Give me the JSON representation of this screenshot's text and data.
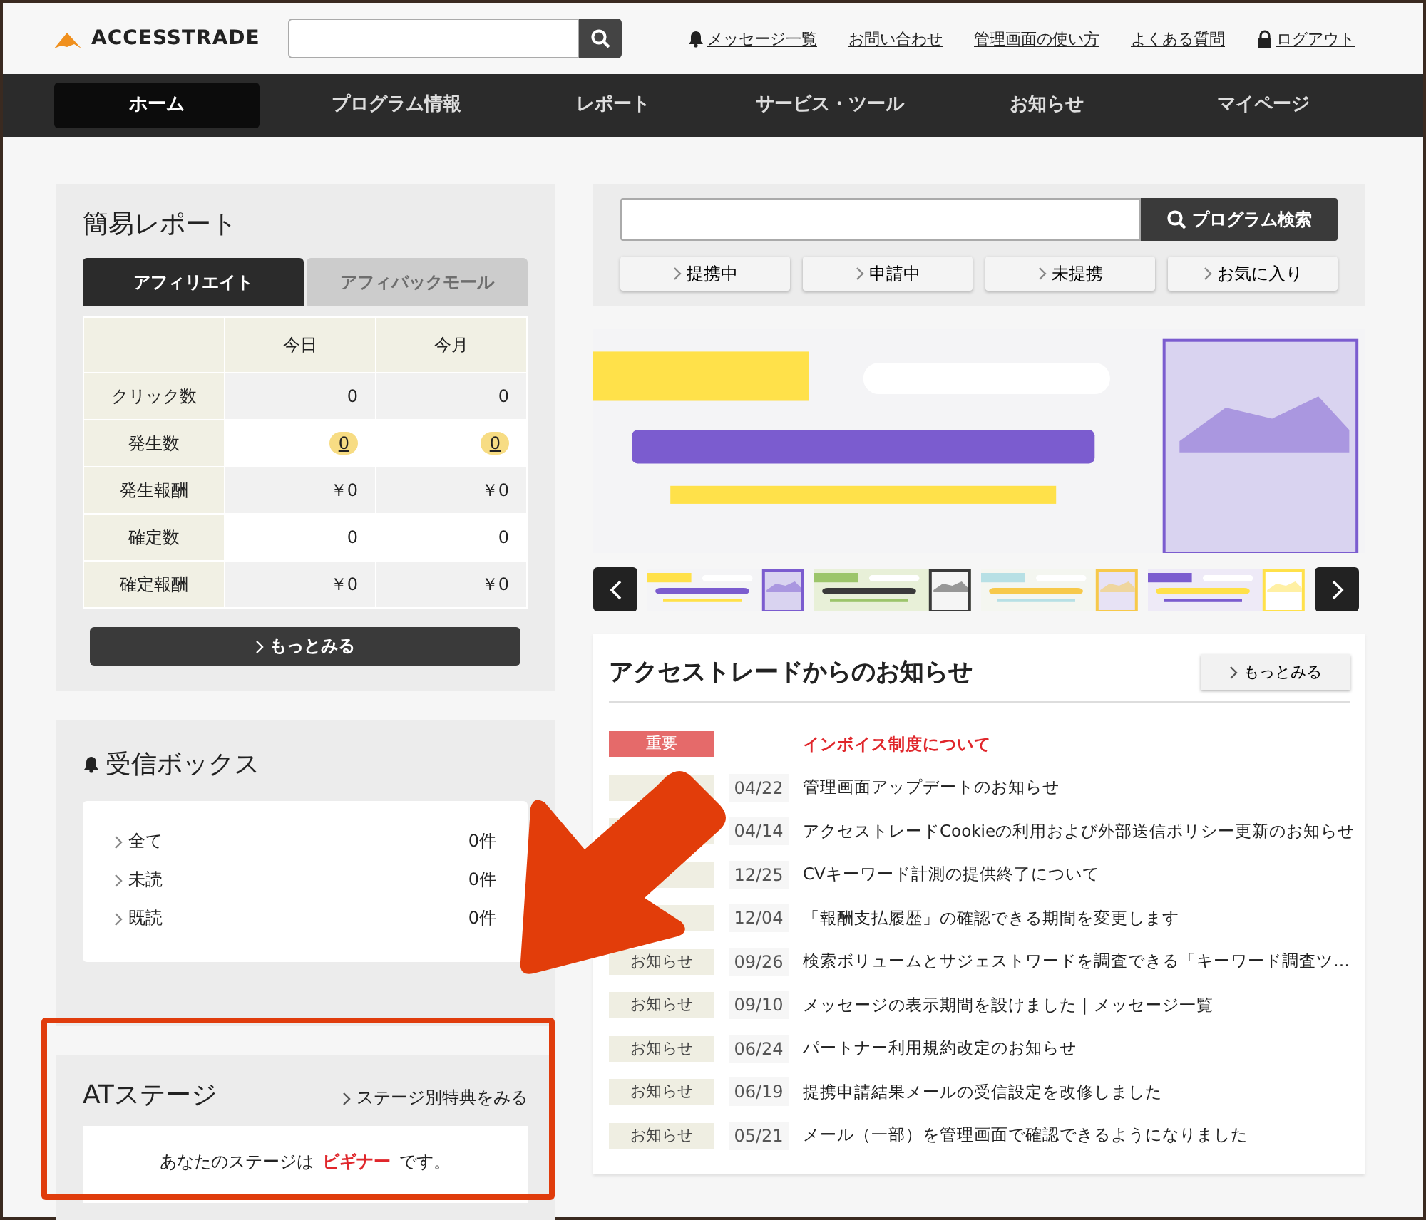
{
  "header": {
    "logo": "ACCESSTRADE",
    "links": [
      {
        "text": "メッセージ一覧",
        "kind": "messages"
      },
      {
        "text": "お問い合わせ",
        "kind": "plain"
      },
      {
        "text": "管理画面の使い方",
        "kind": "plain"
      },
      {
        "text": "よくある質問",
        "kind": "plain"
      },
      {
        "text": "ログアウト",
        "kind": "logout"
      }
    ]
  },
  "nav": [
    {
      "label": "ホーム",
      "selected": true
    },
    {
      "label": "プログラム情報",
      "selected": false
    },
    {
      "label": "レポート",
      "selected": false
    },
    {
      "label": "サービス・ツール",
      "selected": false
    },
    {
      "label": "お知らせ",
      "selected": false
    },
    {
      "label": "マイページ",
      "selected": false
    }
  ],
  "report": {
    "title": "簡易レポート",
    "tabs": [
      {
        "label": "アフィリエイト",
        "selected": true
      },
      {
        "label": "アフィバックモール",
        "selected": false
      }
    ],
    "columns": [
      "今日",
      "今月"
    ],
    "rows": [
      {
        "label": "クリック数",
        "today": "0",
        "month": "0",
        "linked": false
      },
      {
        "label": "発生数",
        "today": "0",
        "month": "0",
        "linked": true
      },
      {
        "label": "発生報酬",
        "today": "￥0",
        "month": "￥0",
        "linked": false
      },
      {
        "label": "確定数",
        "today": "0",
        "month": "0",
        "linked": false
      },
      {
        "label": "確定報酬",
        "today": "￥0",
        "month": "￥0",
        "linked": false
      }
    ],
    "more": "もっとみる"
  },
  "inbox": {
    "title": "受信ボックス",
    "items": [
      {
        "label": "全て",
        "count": "0件"
      },
      {
        "label": "未読",
        "count": "0件"
      },
      {
        "label": "既読",
        "count": "0件"
      }
    ]
  },
  "at_stage": {
    "title": "ATステージ",
    "link": "ステージ別特典をみる",
    "message_before": "あなたのステージは",
    "stage": "ビギナー",
    "message_after": "です。"
  },
  "program_search": {
    "button": "プログラム検索",
    "filters": [
      "提携中",
      "申請中",
      "未提携",
      "お気に入り"
    ]
  },
  "banner": {
    "kind": "picture"
  },
  "news": {
    "title": "アクセストレードからのお知らせ",
    "more": "もっとみる",
    "items": [
      {
        "kind": "important",
        "tag": "重要",
        "title": "インボイス制度について"
      },
      {
        "kind": "notice",
        "date": "04/22",
        "title": "管理画面アップデートのお知らせ"
      },
      {
        "kind": "notice",
        "date": "04/14",
        "title": "アクセストレードCookieの利用および外部送信ポリシー更新のお知らせ"
      },
      {
        "kind": "notice",
        "date": "12/25",
        "title": "CVキーワード計測の提供終了について"
      },
      {
        "kind": "notice",
        "date": "12/04",
        "title": "「報酬支払履歴」の確認できる期間を変更します"
      },
      {
        "kind": "notice",
        "tag": "お知らせ",
        "date": "09/26",
        "title": "検索ボリュームとサジェストワードを調査できる「キーワード調査ツ…"
      },
      {
        "kind": "notice",
        "tag": "お知らせ",
        "date": "09/10",
        "title": "メッセージの表示期間を設けました｜メッセージ一覧"
      },
      {
        "kind": "notice",
        "tag": "お知らせ",
        "date": "06/24",
        "title": "パートナー利用規約改定のお知らせ"
      },
      {
        "kind": "notice",
        "tag": "お知らせ",
        "date": "06/19",
        "title": "提携申請結果メールの受信設定を改修しました"
      },
      {
        "kind": "notice",
        "tag": "お知らせ",
        "date": "05/21",
        "title": "メール（一部）を管理画面で確認できるようになりました"
      }
    ]
  },
  "annotations": {
    "arrow": true,
    "highlight_frame": true
  }
}
